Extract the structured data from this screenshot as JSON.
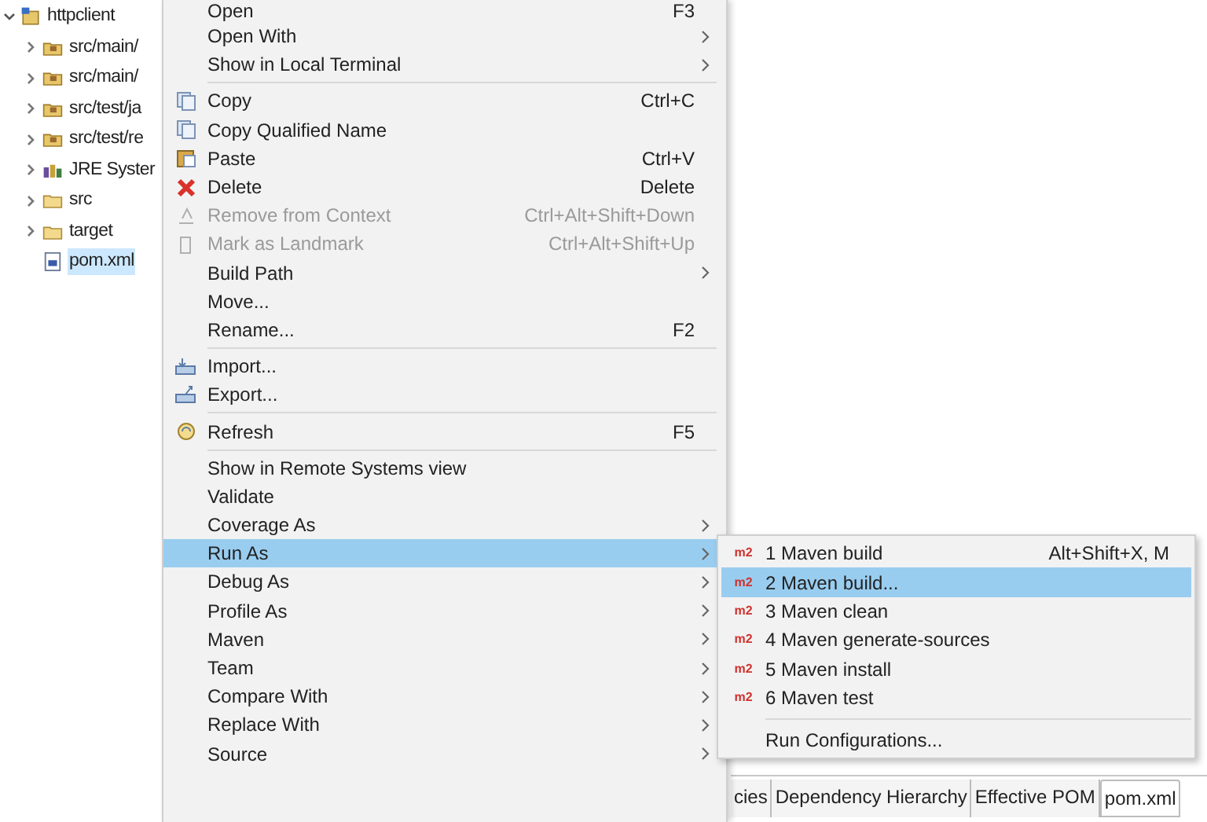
{
  "tree": [
    {
      "label": "httpclient",
      "kind": "project",
      "expanded": true,
      "selected": false,
      "children": [
        {
          "label": "src/main/",
          "kind": "package-folder",
          "expanded": false,
          "selected": false
        },
        {
          "label": "src/main/",
          "kind": "package-folder",
          "expanded": false,
          "selected": false
        },
        {
          "label": "src/test/ja",
          "kind": "package-folder",
          "expanded": false,
          "selected": false
        },
        {
          "label": "src/test/re",
          "kind": "package-folder",
          "expanded": false,
          "selected": false
        },
        {
          "label": "JRE Syster",
          "kind": "library",
          "expanded": false,
          "selected": false
        },
        {
          "label": "src",
          "kind": "folder",
          "expanded": false,
          "selected": false
        },
        {
          "label": "target",
          "kind": "folder",
          "expanded": false,
          "selected": false
        },
        {
          "label": "pom.xml",
          "kind": "file",
          "selected": true
        }
      ]
    }
  ],
  "context_menu": [
    {
      "kind": "item",
      "label": "Open",
      "shortcut": "F3",
      "submenu": false,
      "disabled": false,
      "selected": false
    },
    {
      "kind": "item",
      "label": "Open With",
      "submenu": true,
      "disabled": false,
      "selected": false
    },
    {
      "kind": "item",
      "label": "Show in Local Terminal",
      "submenu": true,
      "disabled": false,
      "selected": false
    },
    {
      "kind": "separator"
    },
    {
      "kind": "copy",
      "label": "Copy",
      "shortcut": "Ctrl+C",
      "submenu": false,
      "disabled": false,
      "selected": false
    },
    {
      "kind": "copy",
      "label": "Copy Qualified Name",
      "submenu": false,
      "disabled": false,
      "selected": false
    },
    {
      "kind": "paste",
      "label": "Paste",
      "shortcut": "Ctrl+V",
      "submenu": false,
      "disabled": false,
      "selected": false
    },
    {
      "kind": "delete",
      "label": "Delete",
      "shortcut": "Delete",
      "submenu": false,
      "disabled": false,
      "selected": false
    },
    {
      "kind": "remove",
      "label": "Remove from Context",
      "shortcut": "Ctrl+Alt+Shift+Down",
      "submenu": false,
      "disabled": true,
      "selected": false
    },
    {
      "kind": "landmark",
      "label": "Mark as Landmark",
      "shortcut": "Ctrl+Alt+Shift+Up",
      "submenu": false,
      "disabled": true,
      "selected": false
    },
    {
      "kind": "item",
      "label": "Build Path",
      "submenu": true,
      "disabled": false,
      "selected": false
    },
    {
      "kind": "item",
      "label": "Move...",
      "submenu": false,
      "disabled": false,
      "selected": false
    },
    {
      "kind": "item",
      "label": "Rename...",
      "shortcut": "F2",
      "submenu": false,
      "disabled": false,
      "selected": false
    },
    {
      "kind": "separator"
    },
    {
      "kind": "import",
      "label": "Import...",
      "submenu": false,
      "disabled": false,
      "selected": false
    },
    {
      "kind": "export",
      "label": "Export...",
      "submenu": false,
      "disabled": false,
      "selected": false
    },
    {
      "kind": "separator"
    },
    {
      "kind": "refresh",
      "label": "Refresh",
      "shortcut": "F5",
      "submenu": false,
      "disabled": false,
      "selected": false
    },
    {
      "kind": "separator"
    },
    {
      "kind": "item",
      "label": "Show in Remote Systems view",
      "submenu": false,
      "disabled": false,
      "selected": false
    },
    {
      "kind": "item",
      "label": "Validate",
      "submenu": false,
      "disabled": false,
      "selected": false
    },
    {
      "kind": "item",
      "label": "Coverage As",
      "submenu": true,
      "disabled": false,
      "selected": false
    },
    {
      "kind": "item",
      "label": "Run As",
      "submenu": true,
      "disabled": false,
      "selected": true,
      "expanded": true
    },
    {
      "kind": "item",
      "label": "Debug As",
      "submenu": true,
      "disabled": false,
      "selected": false
    },
    {
      "kind": "item",
      "label": "Profile As",
      "submenu": true,
      "disabled": false,
      "selected": false
    },
    {
      "kind": "item",
      "label": "Maven",
      "submenu": true,
      "disabled": false,
      "selected": false
    },
    {
      "kind": "item",
      "label": "Team",
      "submenu": true,
      "disabled": false,
      "selected": false
    },
    {
      "kind": "item",
      "label": "Compare With",
      "submenu": true,
      "disabled": false,
      "selected": false
    },
    {
      "kind": "item",
      "label": "Replace With",
      "submenu": true,
      "disabled": false,
      "selected": false
    },
    {
      "kind": "item",
      "label": "Source",
      "submenu": true,
      "disabled": false,
      "selected": false
    }
  ],
  "run_as_submenu": [
    {
      "kind": "item",
      "badge": "m2",
      "label": "1 Maven build",
      "shortcut": "Alt+Shift+X, M",
      "selected": false
    },
    {
      "kind": "item",
      "badge": "m2",
      "label": "2 Maven build...",
      "selected": true
    },
    {
      "kind": "item",
      "badge": "m2",
      "label": "3 Maven clean",
      "selected": false
    },
    {
      "kind": "item",
      "badge": "m2",
      "label": "4 Maven generate-sources",
      "selected": false
    },
    {
      "kind": "item",
      "badge": "m2",
      "label": "5 Maven install",
      "selected": false
    },
    {
      "kind": "item",
      "badge": "m2",
      "label": "6 Maven test",
      "selected": false
    },
    {
      "kind": "separator"
    },
    {
      "kind": "item",
      "label": "Run Configurations...",
      "selected": false
    }
  ],
  "editor_tabs": [
    {
      "label": "cies",
      "selected": false
    },
    {
      "label": "Dependency Hierarchy",
      "selected": false
    },
    {
      "label": "Effective POM",
      "selected": false
    },
    {
      "label": "pom.xml",
      "selected": true
    }
  ]
}
